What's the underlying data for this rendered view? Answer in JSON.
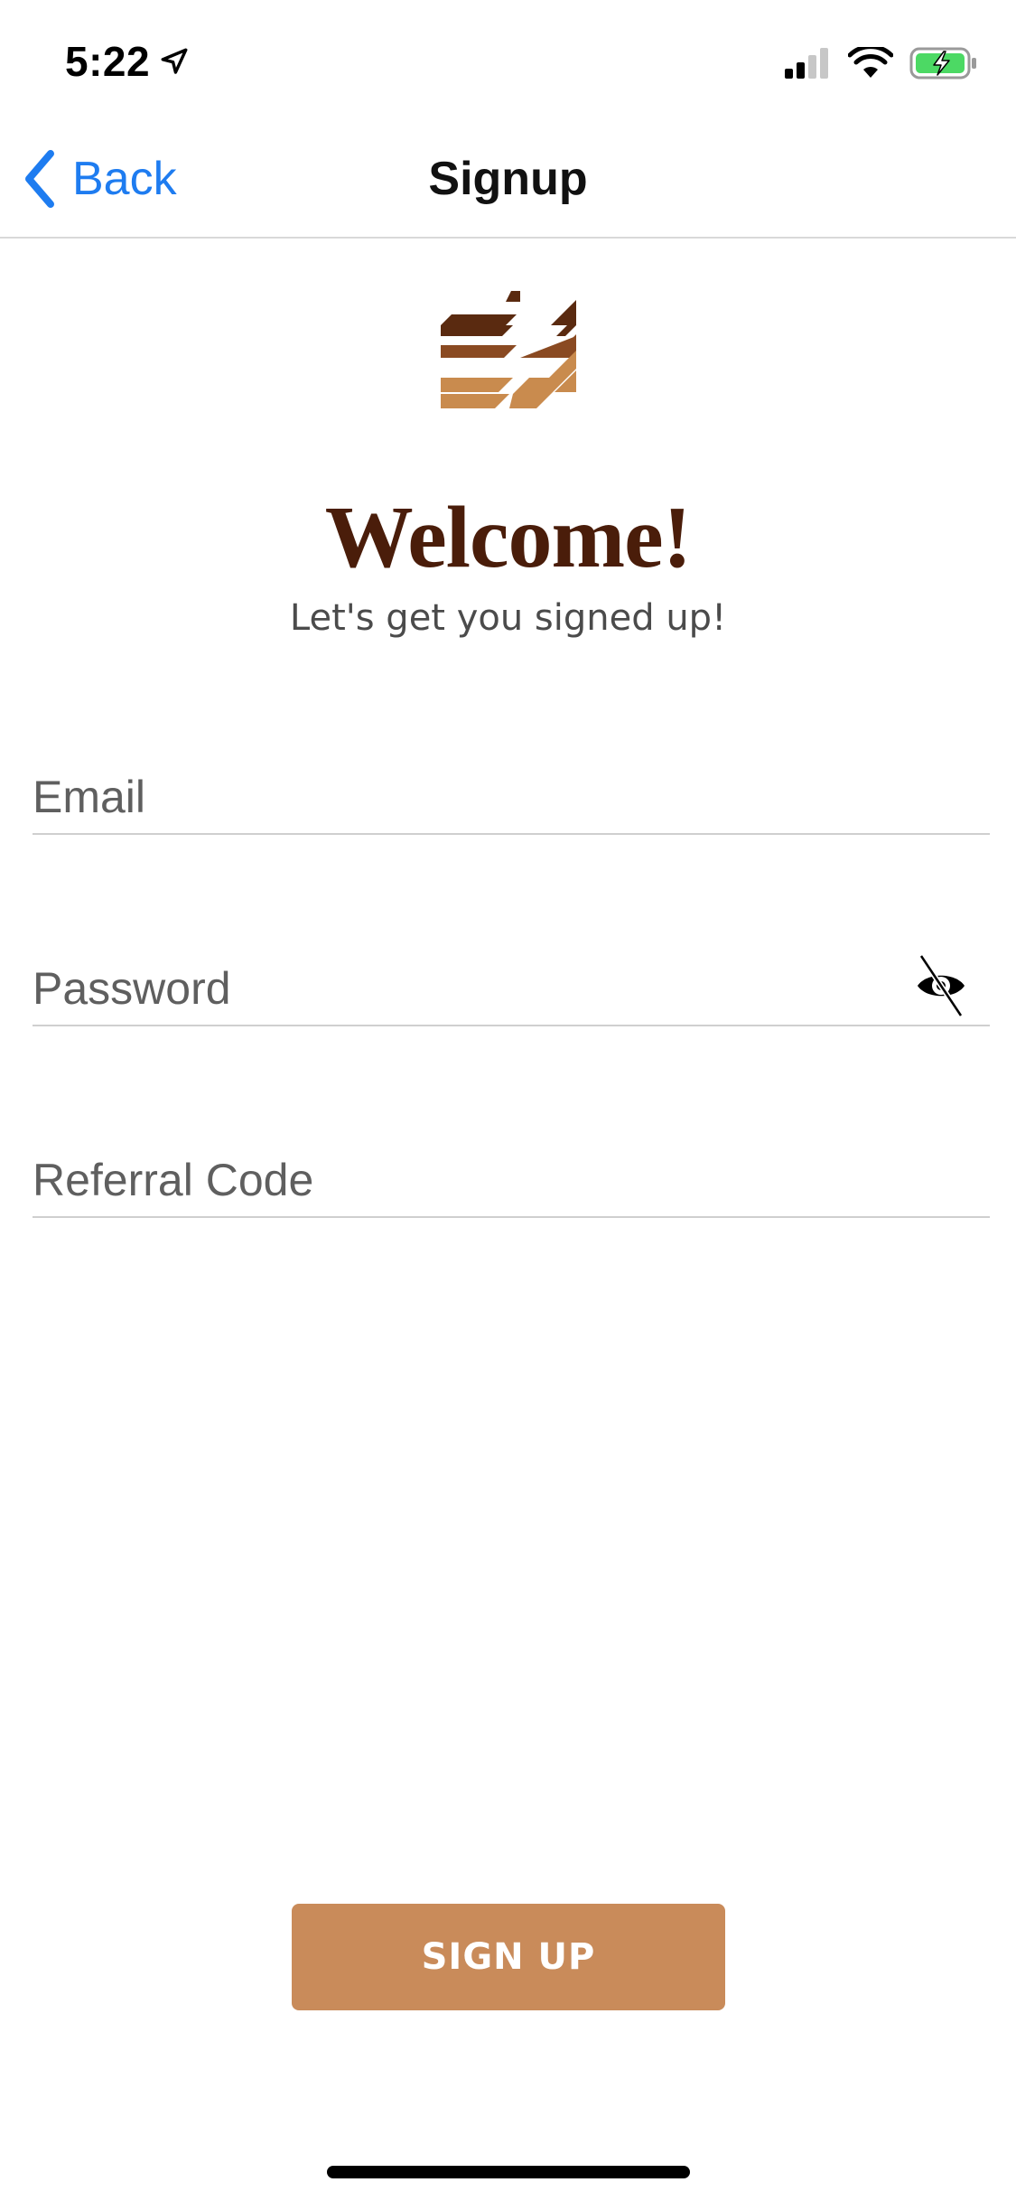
{
  "status_bar": {
    "time": "5:22",
    "icons": {
      "location": "location-arrow-icon",
      "signal": "cellular-signal-icon",
      "wifi": "wifi-icon",
      "battery": "battery-charging-icon"
    }
  },
  "nav": {
    "back_label": "Back",
    "title": "Signup"
  },
  "header": {
    "logo": "brand-logo-icon",
    "title": "Welcome!",
    "subtitle": "Let's get you signed up!"
  },
  "form": {
    "email": {
      "value": "",
      "placeholder": "Email"
    },
    "password": {
      "value": "",
      "placeholder": "Password",
      "toggle_icon": "eye-slash-icon"
    },
    "referral": {
      "value": "",
      "placeholder": "Referral Code"
    }
  },
  "actions": {
    "signup_label": "SIGN UP"
  },
  "colors": {
    "accent_blue": "#1e7cf0",
    "brand_dark_brown": "#4a1d0a",
    "button_tan": "#c98b5a",
    "logo_dark": "#5a2a10",
    "logo_mid": "#8a4a22",
    "logo_light": "#c98b4e",
    "battery_green": "#4cd964"
  }
}
